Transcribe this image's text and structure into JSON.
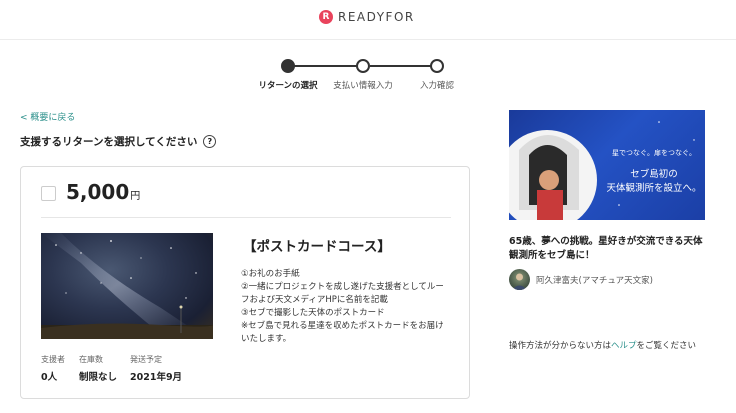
{
  "header": {
    "brand": "READYFOR",
    "logo_mark": "R"
  },
  "stepper": {
    "steps": [
      {
        "label": "リターンの選択",
        "active": true
      },
      {
        "label": "支払い情報入力",
        "active": false
      },
      {
        "label": "入力確認",
        "active": false
      }
    ]
  },
  "nav": {
    "back_label": "< 概要に戻る"
  },
  "section": {
    "title": "支援するリターンを選択してください",
    "help_glyph": "?"
  },
  "reward": {
    "price": "5,000",
    "unit": "円",
    "title": "【ポストカードコース】",
    "description": [
      "①お礼のお手紙",
      "②一緒にプロジェクトを成し遂げた支援者としてルー",
      "フおよび天文メディアHPに名前を記載",
      "③セブで撮影した天体のポストカード",
      "※セブ島で見れる星達を収めたポストカードをお届け",
      "いたします。"
    ],
    "meta": [
      {
        "label": "支援者",
        "value": "0人"
      },
      {
        "label": "在庫数",
        "value": "制限なし"
      },
      {
        "label": "発送予定",
        "value": "2021年9月"
      }
    ]
  },
  "sidebar": {
    "banner_line1": "星でつなぐ。扉をつなぐ。",
    "banner_line2": "セブ島初の",
    "banner_line3": "天体観測所を設立へ。",
    "project_title": "65歳、夢への挑戦。星好きが交流できる天体観測所をセブ島に！",
    "author": "阿久津富夫(アマチュア天文家)",
    "help_prefix": "操作方法が分からない方は",
    "help_link": "ヘルプ",
    "help_suffix": "をご覧ください"
  },
  "colors": {
    "accent": "#2a8f8a",
    "brand": "#e9435c",
    "banner_blue": "#2452c4"
  }
}
